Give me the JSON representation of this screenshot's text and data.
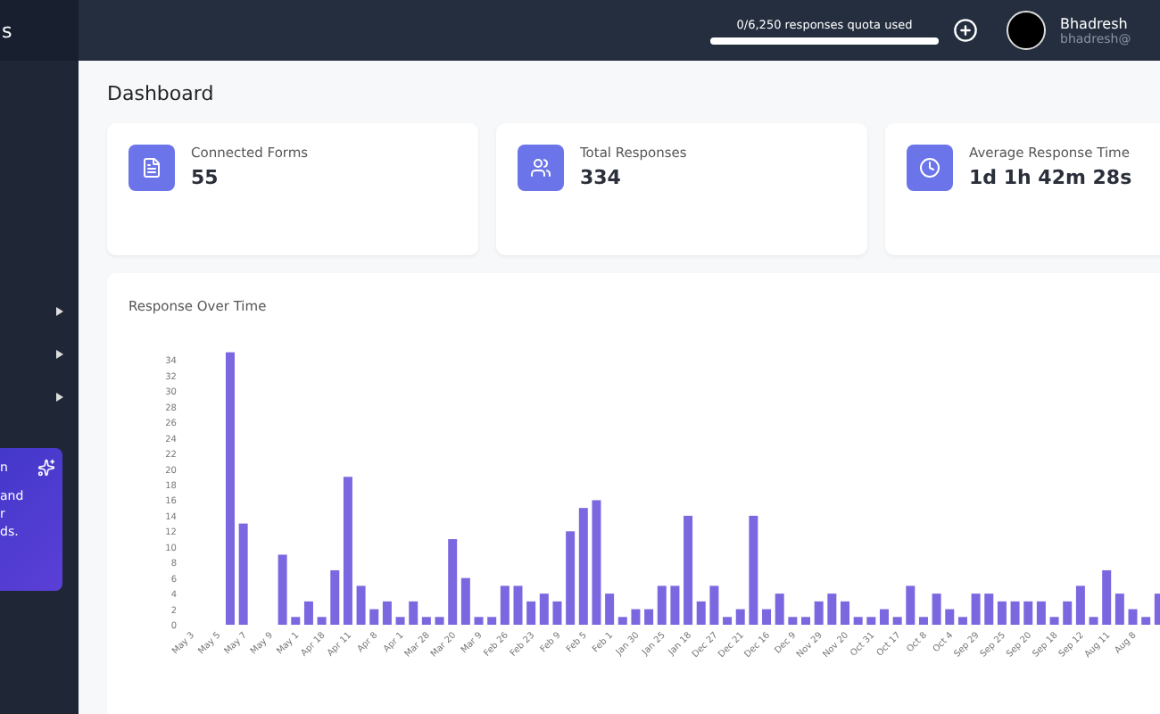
{
  "sidebar": {
    "brand_fragment": "s",
    "items": [
      {
        "expanded": false
      },
      {
        "expanded": false
      },
      {
        "expanded": false
      }
    ],
    "promo": {
      "lines": [
        "n",
        "and",
        "r",
        "ds."
      ]
    }
  },
  "topbar": {
    "quota": {
      "label": "0/6,250 responses quota used",
      "level": 0
    },
    "user": {
      "name": "Bhadresh",
      "email": "bhadresh@"
    }
  },
  "page": {
    "title": "Dashboard"
  },
  "stats": [
    {
      "kind": "forms",
      "label": "Connected Forms",
      "value": "55"
    },
    {
      "kind": "responses",
      "label": "Total Responses",
      "value": "334"
    },
    {
      "kind": "time",
      "label": "Average Response Time",
      "value": "1d 1h 42m 28s"
    }
  ],
  "chart": {
    "title": "Response Over Time",
    "chart_data": {
      "type": "bar",
      "categories": [
        "May 3",
        null,
        "May 5",
        null,
        "May 7",
        null,
        "May 9",
        null,
        "May 1",
        null,
        "Apr 18",
        null,
        "Apr 11",
        null,
        "Apr 8",
        null,
        "Apr 1",
        null,
        "Mar 28",
        null,
        "Mar 20",
        null,
        "Mar 9",
        null,
        "Feb 26",
        null,
        "Feb 23",
        null,
        "Feb 9",
        null,
        "Feb 5",
        null,
        "Feb 1",
        null,
        "Jan 30",
        null,
        "Jan 25",
        null,
        "Jan 18",
        null,
        "Dec 27",
        null,
        "Dec 21",
        null,
        "Dec 16",
        null,
        "Dec 9",
        null,
        "Nov 29",
        null,
        "Nov 20",
        null,
        "Oct 31",
        null,
        "Oct 17",
        null,
        "Oct 8",
        null,
        "Oct 4",
        null,
        "Sep 29",
        null,
        "Sep 25",
        null,
        "Sep 20",
        null,
        "Sep 18",
        null,
        "Sep 12",
        null,
        "Aug 11",
        null,
        "Aug 8",
        null,
        null
      ],
      "series": [
        {
          "color": "#7b68e0",
          "values": [
            0,
            0,
            0,
            35,
            13,
            0,
            0,
            9,
            1,
            3,
            1,
            7,
            19,
            5,
            2,
            3,
            1,
            3,
            1,
            1,
            11,
            6,
            1,
            1,
            5,
            5,
            3,
            4,
            3,
            12,
            15,
            16,
            4,
            1,
            2,
            2,
            5,
            5,
            14,
            3,
            5,
            1,
            2,
            14,
            2,
            4,
            1,
            1,
            3,
            4,
            3,
            1,
            1,
            2,
            1,
            5,
            1,
            4,
            2,
            1,
            4,
            4,
            3,
            3,
            3,
            3,
            1,
            3,
            5,
            1,
            7,
            4,
            2,
            1,
            4
          ]
        }
      ],
      "ylim": [
        0,
        36
      ],
      "yticks": [
        0,
        2,
        4,
        6,
        8,
        10,
        12,
        14,
        16,
        18,
        20,
        22,
        24,
        26,
        28,
        30,
        32,
        34
      ]
    }
  }
}
